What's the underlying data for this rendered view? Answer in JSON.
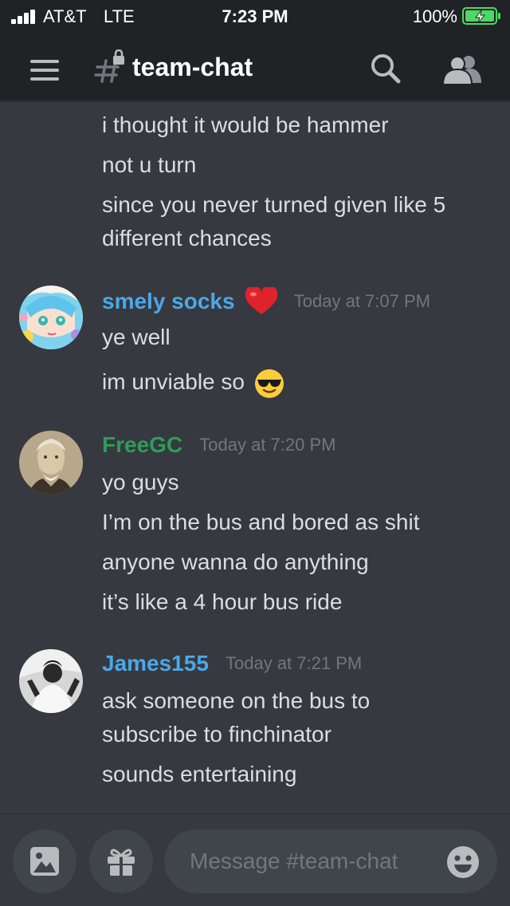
{
  "status_bar": {
    "carrier": "AT&T",
    "network": "LTE",
    "time": "7:23 PM",
    "battery": "100%"
  },
  "header": {
    "channel_name": "team-chat",
    "icons": [
      "menu-icon",
      "locked-channel-hash-icon",
      "search-icon",
      "members-icon"
    ]
  },
  "messages": [
    {
      "author": null,
      "lines": [
        "i thought it would be hammer",
        "not u turn",
        "since you never turned given like 5",
        "different chances"
      ]
    },
    {
      "author": "smely socks",
      "author_color": "#4aa8e8",
      "badge_icon": "red-heart-icon",
      "timestamp": "Today at 7:07 PM",
      "lines": [
        "ye well",
        "im unviable so"
      ],
      "inline_emoji": "smiling-face-with-sunglasses-icon"
    },
    {
      "author": "FreeGC",
      "author_color": "#2d9c5a",
      "timestamp": "Today at 7:20 PM",
      "lines": [
        "yo guys",
        "I’m on the bus and bored as shit",
        "anyone wanna do anything",
        "it’s like a 4 hour bus ride"
      ]
    },
    {
      "author": "James155",
      "author_color": "#4aa8e8",
      "timestamp": "Today at 7:21 PM",
      "lines": [
        "ask someone on the bus to",
        "subscribe to finchinator",
        "sounds entertaining"
      ]
    }
  ],
  "composer": {
    "placeholder": "Message #team-chat",
    "icons": [
      "image-icon",
      "gift-icon",
      "emoji-icon"
    ]
  }
}
